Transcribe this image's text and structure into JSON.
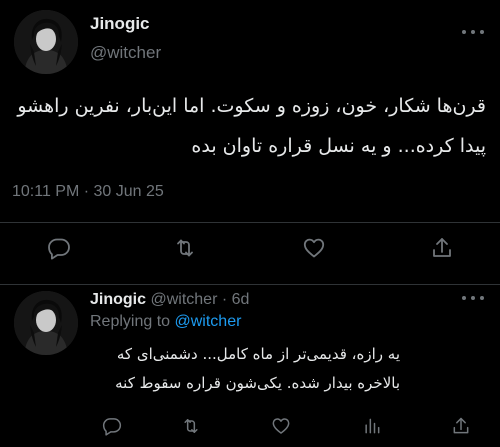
{
  "main_tweet": {
    "display_name": "Jinogic",
    "handle": "@witcher",
    "text": "قرن‌ها شکار، خون، زوزه و سکوت. اما این‌بار، نفرین راهشو پیدا کرده... و یه نسل قراره تاوان بده",
    "timestamp": "10:11 PM · 30 Jun 25"
  },
  "reply_tweet": {
    "display_name": "Jinogic",
    "handle": "@witcher",
    "separator": " · ",
    "time_ago": "6d",
    "replying_prefix": "Replying to ",
    "replying_to": "@witcher",
    "text": "یه رازه، قدیمی‌تر از ماه کامل... دشمنی‌ای که بالاخره بیدار شده. یکی‌شون قراره سقوط کنه"
  },
  "icons": {
    "more": "more-horizontal-icon",
    "reply": "reply-icon",
    "retweet": "retweet-icon",
    "like": "heart-icon",
    "views": "views-icon",
    "share": "share-icon"
  },
  "colors": {
    "background": "#000000",
    "text": "#e7e9ea",
    "secondary": "#71767b",
    "link": "#1d9bf0",
    "divider": "#2f3336"
  }
}
